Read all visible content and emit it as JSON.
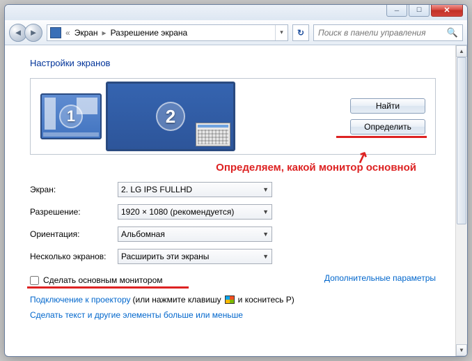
{
  "breadcrumb": {
    "seg1": "Экран",
    "seg2": "Разрешение экрана"
  },
  "search": {
    "placeholder": "Поиск в панели управления"
  },
  "page": {
    "title": "Настройки экранов"
  },
  "buttons": {
    "find": "Найти",
    "detect": "Определить"
  },
  "monitors": {
    "m1": "1",
    "m2": "2"
  },
  "annotation": {
    "text": "Определяем, какой монитор основной"
  },
  "labels": {
    "screen": "Экран:",
    "resolution": "Разрешение:",
    "orientation": "Ориентация:",
    "multiple": "Несколько экранов:"
  },
  "values": {
    "screen": "2. LG IPS FULLHD",
    "resolution": "1920 × 1080 (рекомендуется)",
    "orientation": "Альбомная",
    "multiple": "Расширить эти экраны"
  },
  "checkbox": {
    "make_main": "Сделать основным монитором"
  },
  "links": {
    "advanced": "Дополнительные параметры",
    "projector_pre": "Подключение к проектору",
    "projector_post": " (или нажмите клавишу ",
    "projector_tail": " и коснитесь P)",
    "bigger": "Сделать текст и другие элементы больше или меньше"
  }
}
